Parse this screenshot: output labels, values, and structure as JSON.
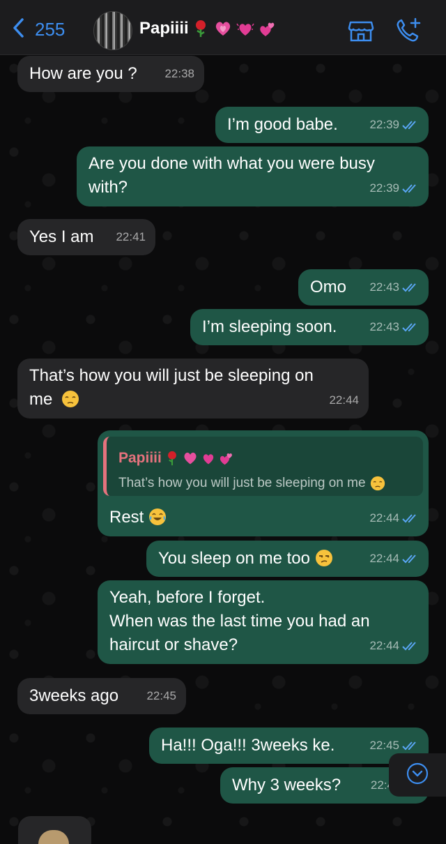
{
  "header": {
    "back_count": "255",
    "contact_name": "Papiiii",
    "name_emojis": [
      "rose",
      "growing-heart",
      "beating-heart",
      "two-hearts"
    ],
    "icons": [
      "chevron-left-icon",
      "store-icon",
      "add-call-icon"
    ],
    "accent_color": "#3d8ef0"
  },
  "messages": [
    {
      "dir": "in",
      "text": "How are you ?",
      "time": "22:38"
    },
    {
      "dir": "out",
      "text": "I’m good babe.",
      "time": "22:39"
    },
    {
      "dir": "out",
      "lines": [
        "Are you done with what you were busy",
        "with?"
      ],
      "time": "22:39"
    },
    {
      "dir": "in",
      "text": "Yes I am",
      "time": "22:41"
    },
    {
      "dir": "out",
      "text": "Omo",
      "time": "22:43"
    },
    {
      "dir": "out",
      "text": "I’m sleeping soon.",
      "time": "22:43"
    },
    {
      "dir": "in",
      "lines": [
        "That’s how you will just be sleeping on",
        "me"
      ],
      "emoji": "pensive-face",
      "time": "22:44"
    },
    {
      "dir": "out",
      "reply": {
        "name": "Papiiii",
        "text": "That’s how you will just be sleeping on me"
      },
      "text": "Rest",
      "emoji": "tears-of-joy-face",
      "time": "22:44"
    },
    {
      "dir": "out",
      "text": "You sleep on me too",
      "emoji": "unamused-face",
      "time": "22:44"
    },
    {
      "dir": "out",
      "lines": [
        "Yeah, before I forget.",
        "When was the last time you had an",
        "haircut or shave?"
      ],
      "time": "22:44"
    },
    {
      "dir": "in",
      "text": "3weeks ago",
      "time": "22:45"
    },
    {
      "dir": "out",
      "text": "Ha!!! Oga!!! 3weeks ke.",
      "time": "22:45"
    },
    {
      "dir": "out",
      "text": "Why 3 weeks?",
      "time": "22:4"
    }
  ],
  "colors": {
    "incoming": "#262628",
    "outgoing": "#1f5646",
    "read_ticks": "#5aa6f5",
    "quote_accent": "#e5727d"
  }
}
